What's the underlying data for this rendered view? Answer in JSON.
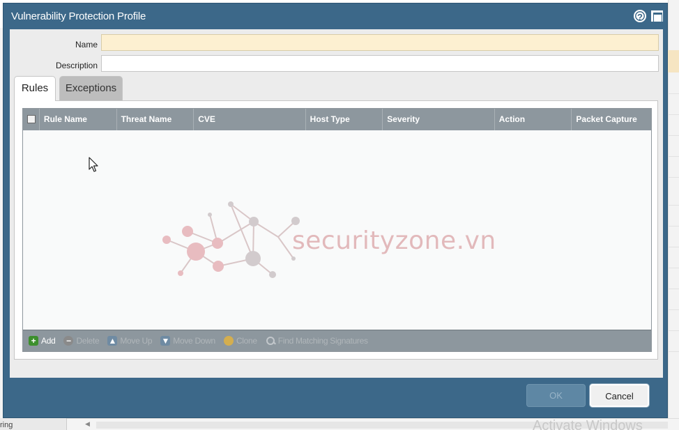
{
  "dialog": {
    "title": "Vulnerability Protection Profile",
    "help_icon": "help-circle-icon",
    "maximize_icon": "maximize-icon"
  },
  "form": {
    "name_label": "Name",
    "name_value": "",
    "description_label": "Description",
    "description_value": ""
  },
  "tabs": [
    {
      "label": "Rules",
      "active": true
    },
    {
      "label": "Exceptions",
      "active": false
    }
  ],
  "grid": {
    "columns": [
      "Rule Name",
      "Threat Name",
      "CVE",
      "Host Type",
      "Severity",
      "Action",
      "Packet Capture"
    ],
    "rows": []
  },
  "toolbar": {
    "add": "Add",
    "delete": "Delete",
    "move_up": "Move Up",
    "move_down": "Move Down",
    "clone": "Clone",
    "find": "Find Matching Signatures"
  },
  "footer": {
    "ok": "OK",
    "cancel": "Cancel"
  },
  "watermark": {
    "text": "securityzone.vn"
  },
  "background": {
    "bottom_left_text": "ring",
    "os_watermark": "Activate Windows"
  },
  "colors": {
    "dialog_frame": "#3c6889",
    "grid_header": "#8d979e",
    "name_field_bg": "#fdf0d1"
  }
}
